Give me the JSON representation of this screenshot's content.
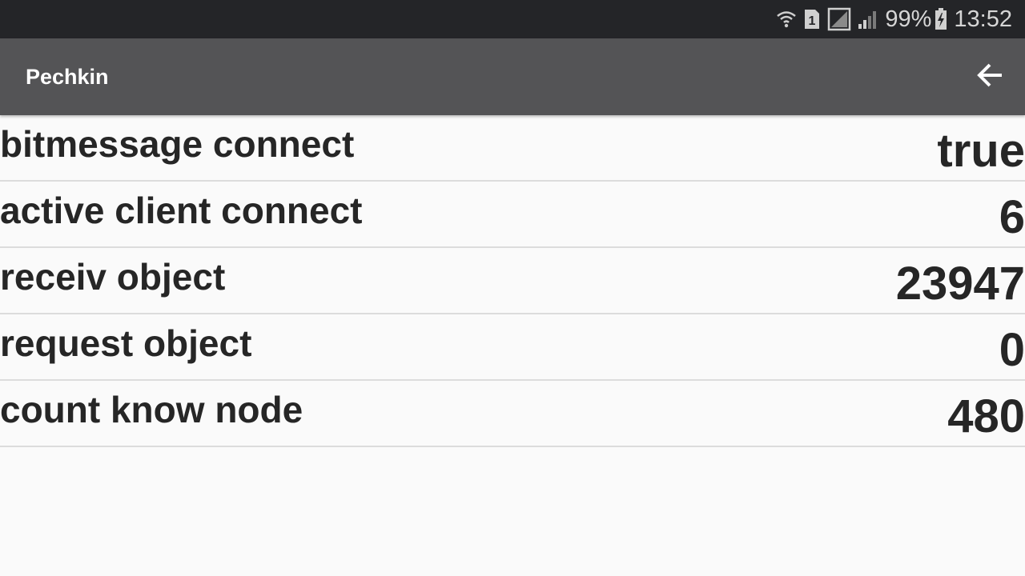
{
  "status_bar": {
    "icons": [
      "wifi-icon",
      "sim-1-icon",
      "no-signal-icon",
      "cell-signal-icon",
      "battery-charging-icon"
    ],
    "sim_slot": "1",
    "battery": "99%",
    "time": "13:52"
  },
  "app_bar": {
    "title": "Pechkin",
    "back_icon": "arrow-left-icon"
  },
  "stats": [
    {
      "label": "bitmessage connect",
      "value": "true"
    },
    {
      "label": "active client connect",
      "value": "6"
    },
    {
      "label": "receiv object",
      "value": "23947"
    },
    {
      "label": "request object",
      "value": "0"
    },
    {
      "label": "count know node",
      "value": "480"
    }
  ],
  "colors": {
    "status_bar_bg": "#242528",
    "app_bar_bg": "#545456",
    "page_bg": "#fafafa",
    "text": "#262626",
    "divider": "#dcdcdc"
  }
}
